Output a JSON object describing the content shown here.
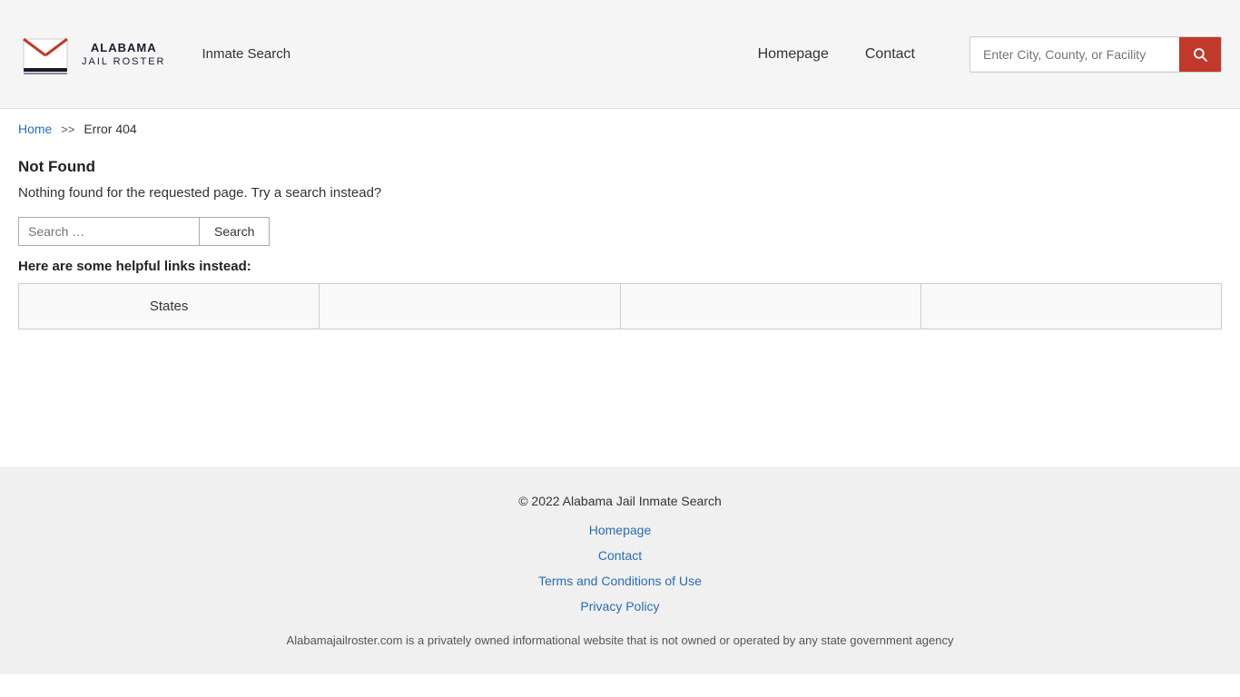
{
  "site": {
    "name": "ALABAMA",
    "sub": "JAIL ROSTER",
    "title": "Alabama Jail Roster"
  },
  "header": {
    "inmate_search_label": "Inmate Search",
    "homepage_label": "Homepage",
    "contact_label": "Contact",
    "search_placeholder": "Enter City, County, or Facility"
  },
  "breadcrumb": {
    "home_label": "Home",
    "separator": ">>",
    "current": "Error 404"
  },
  "main": {
    "not_found_title": "Not Found",
    "not_found_desc": "Nothing found for the requested page. Try a search instead?",
    "search_placeholder": "Search …",
    "search_button_label": "Search",
    "helpful_links_label": "Here are some helpful links instead:",
    "links_table": [
      {
        "label": "States",
        "href": "#"
      },
      {
        "label": "",
        "href": "#"
      },
      {
        "label": "",
        "href": "#"
      },
      {
        "label": "",
        "href": "#"
      }
    ]
  },
  "footer": {
    "copyright": "© 2022 Alabama Jail Inmate Search",
    "homepage_label": "Homepage",
    "contact_label": "Contact",
    "terms_label": "Terms and Conditions of Use",
    "privacy_label": "Privacy Policy",
    "disclaimer": "Alabamajailroster.com is a privately owned informational website that is not owned or operated by any state government agency"
  }
}
